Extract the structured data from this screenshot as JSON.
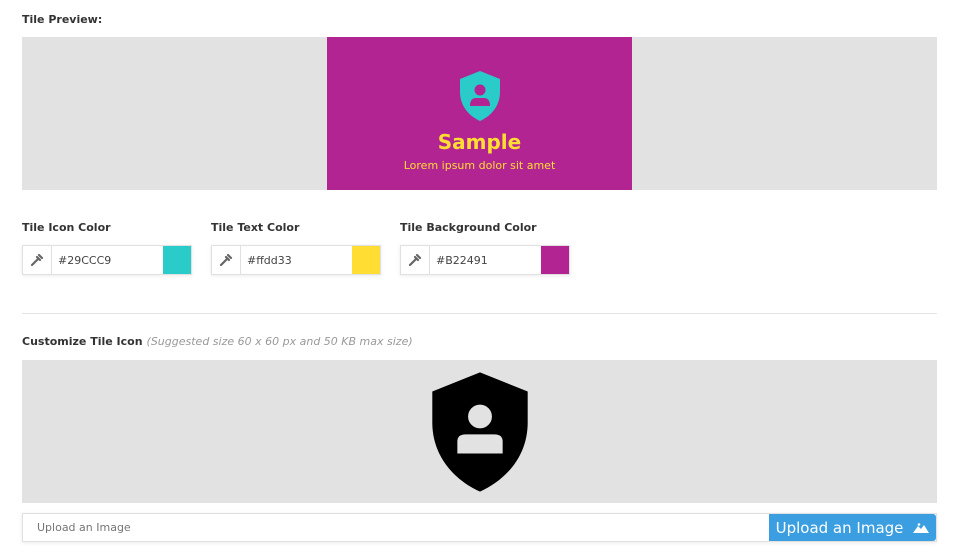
{
  "preview": {
    "label": "Tile Preview:",
    "title": "Sample",
    "subtitle": "Lorem ipsum dolor sit amet"
  },
  "colors": [
    {
      "label": "Tile Icon Color",
      "value": "#29CCC9",
      "swatch": "#29CCC9"
    },
    {
      "label": "Tile Text Color",
      "value": "#ffdd33",
      "swatch": "#ffdd33"
    },
    {
      "label": "Tile Background Color",
      "value": "#B22491",
      "swatch": "#B22491"
    }
  ],
  "customize": {
    "label": "Customize Tile Icon",
    "hint": "(Suggested size 60 x 60 px and 50 KB max size)"
  },
  "upload": {
    "placeholder": "Upload an Image",
    "button_label": "Upload an Image"
  }
}
